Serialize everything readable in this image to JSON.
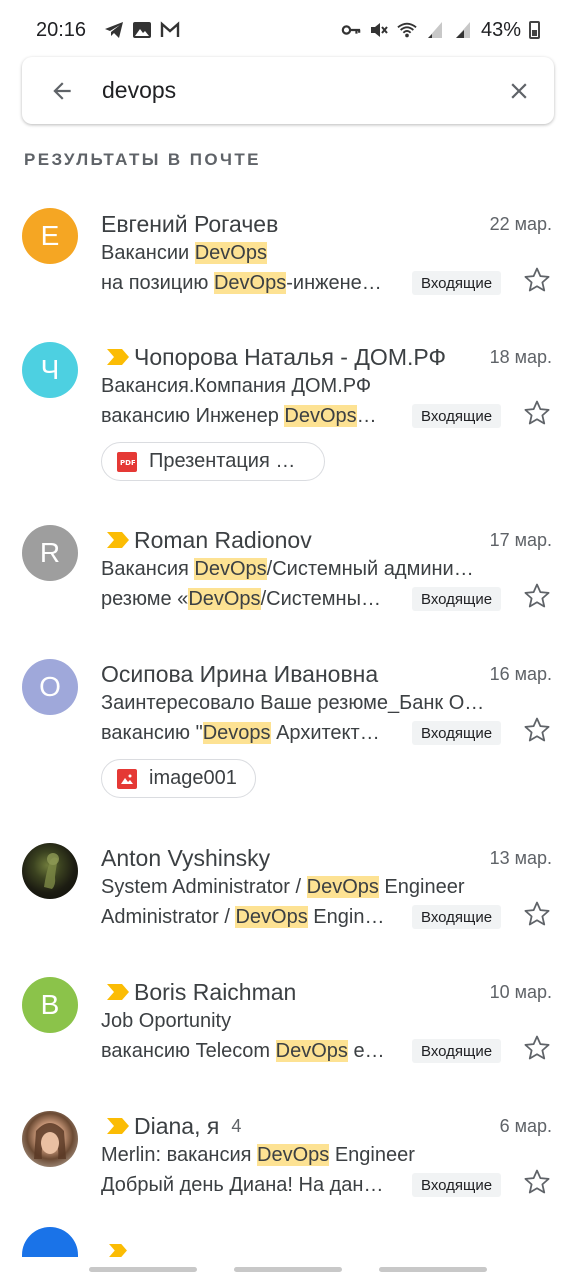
{
  "status_bar": {
    "time": "20:16",
    "battery": "43%"
  },
  "search": {
    "query": "devops"
  },
  "section_header": "РЕЗУЛЬТАТЫ В ПОЧТЕ",
  "label_inbox": "Входящие",
  "colors": {
    "highlight": "#fde293",
    "importance_marker": "#fbbc04"
  },
  "emails": [
    {
      "avatar_letter": "Е",
      "avatar_color": "#f5a623",
      "sender": "Евгений Рогачев",
      "date": "22 мар.",
      "subject": [
        "Вакансии ",
        "DevOps",
        ""
      ],
      "snippet": [
        "на позицию ",
        "DevOps",
        "-инжене…"
      ],
      "label": "Входящие"
    },
    {
      "avatar_letter": "Ч",
      "avatar_color": "#4dd0e1",
      "important": true,
      "sender": "Чопорова Наталья  - ДОМ.РФ",
      "date": "18 мар.",
      "subject": [
        "Вакансия.Компания ДОМ.РФ",
        "",
        ""
      ],
      "snippet": [
        "вакансию Инженер ",
        "DevOps",
        "…"
      ],
      "label": "Входящие",
      "attachment": {
        "name": "Презентация …",
        "icon": "pdf-icon"
      }
    },
    {
      "avatar_letter": "R",
      "avatar_color": "#9e9e9e",
      "important": true,
      "sender": "Roman Radionov",
      "date": "17 мар.",
      "subject": [
        " Вакансия ",
        "DevOps",
        "/Системный админи…"
      ],
      "snippet": [
        "резюме «",
        "DevOps",
        "/Системны…"
      ],
      "label": "Входящие"
    },
    {
      "avatar_letter": "О",
      "avatar_color": "#9fa8da",
      "sender": "Осипова Ирина Ивановна",
      "date": "16 мар.",
      "subject": [
        "Заинтересовало Ваше резюме_Банк О…",
        "",
        ""
      ],
      "snippet": [
        "вакансию \"",
        "Devops",
        " Архитект…"
      ],
      "label": "Входящие",
      "attachment": {
        "name": "image001",
        "icon": "image-icon"
      }
    },
    {
      "avatar_photo": "dark-photo",
      "sender": "Anton Vyshinsky",
      "date": "13 мар.",
      "subject": [
        "System Administrator / ",
        "DevOps",
        " Engineer"
      ],
      "snippet": [
        "Administrator / ",
        "DevOps",
        " Engin…"
      ],
      "label": "Входящие"
    },
    {
      "avatar_letter": "B",
      "avatar_color": "#8bc34a",
      "important": true,
      "sender": "Boris Raichman",
      "date": "10 мар.",
      "subject": [
        "Job Oportunity",
        "",
        ""
      ],
      "snippet": [
        "вакансию Telecom ",
        "DevOps",
        " e…"
      ],
      "label": "Входящие"
    },
    {
      "avatar_photo": "light-photo",
      "important": true,
      "sender": "Diana, я",
      "count": "4",
      "date": "6 мар.",
      "subject": [
        "Merlin: вакансия ",
        "DevOps",
        " Engineer"
      ],
      "snippet": [
        "Добрый день Диана! На дан…",
        "",
        ""
      ],
      "label": "Входящие"
    }
  ]
}
